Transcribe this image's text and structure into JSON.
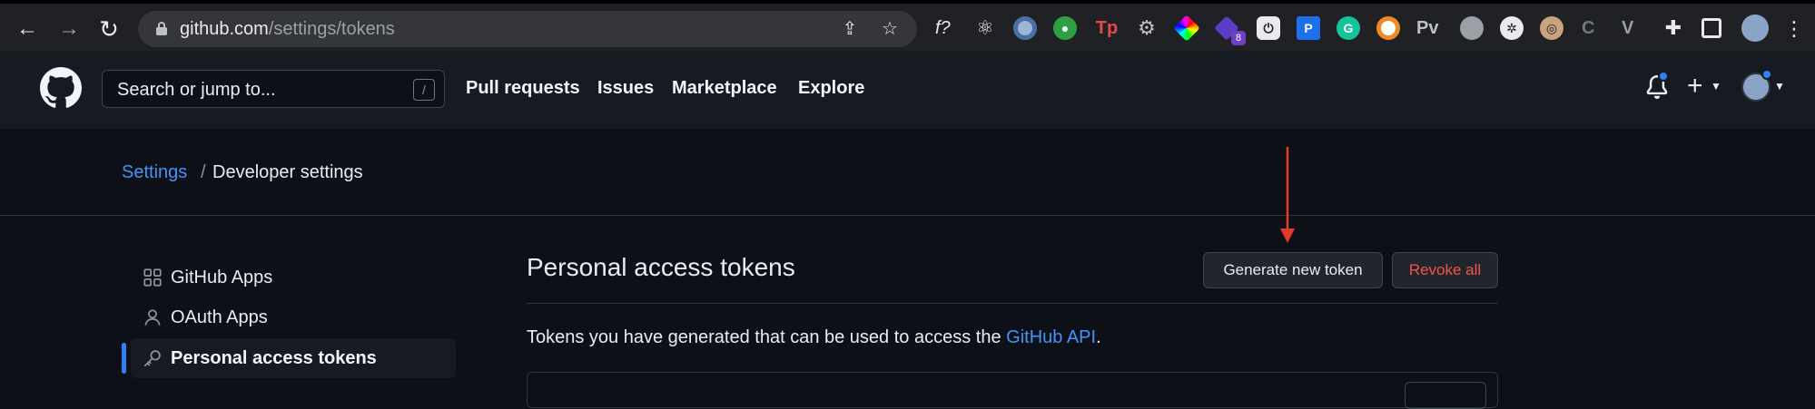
{
  "browser": {
    "url_host": "github.com",
    "url_path": "/settings/tokens",
    "extensions": [
      {
        "name": "formula-ext-icon",
        "label": "f?"
      },
      {
        "name": "react-devtools-icon",
        "label": "⚛"
      },
      {
        "name": "blue-ring-ext-icon",
        "label": ""
      },
      {
        "name": "green-ext-icon",
        "label": ""
      },
      {
        "name": "tp-ext-icon",
        "label": "Tp"
      },
      {
        "name": "gear-ext-icon",
        "label": "⚙"
      },
      {
        "name": "color-ext-icon",
        "label": ""
      },
      {
        "name": "purple-ext-icon",
        "label": ""
      },
      {
        "name": "power-ext-icon",
        "label": "⏻"
      },
      {
        "name": "p-ext-icon",
        "label": "P"
      },
      {
        "name": "grammarly-icon",
        "label": "G"
      },
      {
        "name": "orange-ring-ext-icon",
        "label": ""
      },
      {
        "name": "pv-ext-icon",
        "label": "Pv"
      },
      {
        "name": "gray-circle-ext-icon",
        "label": ""
      },
      {
        "name": "bug-ext-icon",
        "label": ""
      },
      {
        "name": "glasses-ext-icon",
        "label": ""
      },
      {
        "name": "c-ext-icon",
        "label": "C"
      },
      {
        "name": "vue-ext-icon",
        "label": "V"
      }
    ],
    "ext_badge": "8"
  },
  "header": {
    "search_placeholder": "Search or jump to...",
    "search_shortcut": "/",
    "nav": [
      "Pull requests",
      "Issues",
      "Marketplace",
      "Explore"
    ]
  },
  "breadcrumb": {
    "settings": "Settings",
    "separator": "/",
    "current": "Developer settings"
  },
  "sidebar": {
    "items": [
      {
        "label": "GitHub Apps"
      },
      {
        "label": "OAuth Apps"
      },
      {
        "label": "Personal access tokens"
      }
    ]
  },
  "main": {
    "title": "Personal access tokens",
    "generate_button": "Generate new token",
    "revoke_button": "Revoke all",
    "description_prefix": "Tokens you have generated that can be used to access the ",
    "description_link": "GitHub API",
    "description_suffix": "."
  },
  "colors": {
    "accent_blue": "#2f81f7",
    "link_blue": "#4493f8",
    "danger": "#f85149",
    "annotation_arrow": "#e53a2a"
  }
}
